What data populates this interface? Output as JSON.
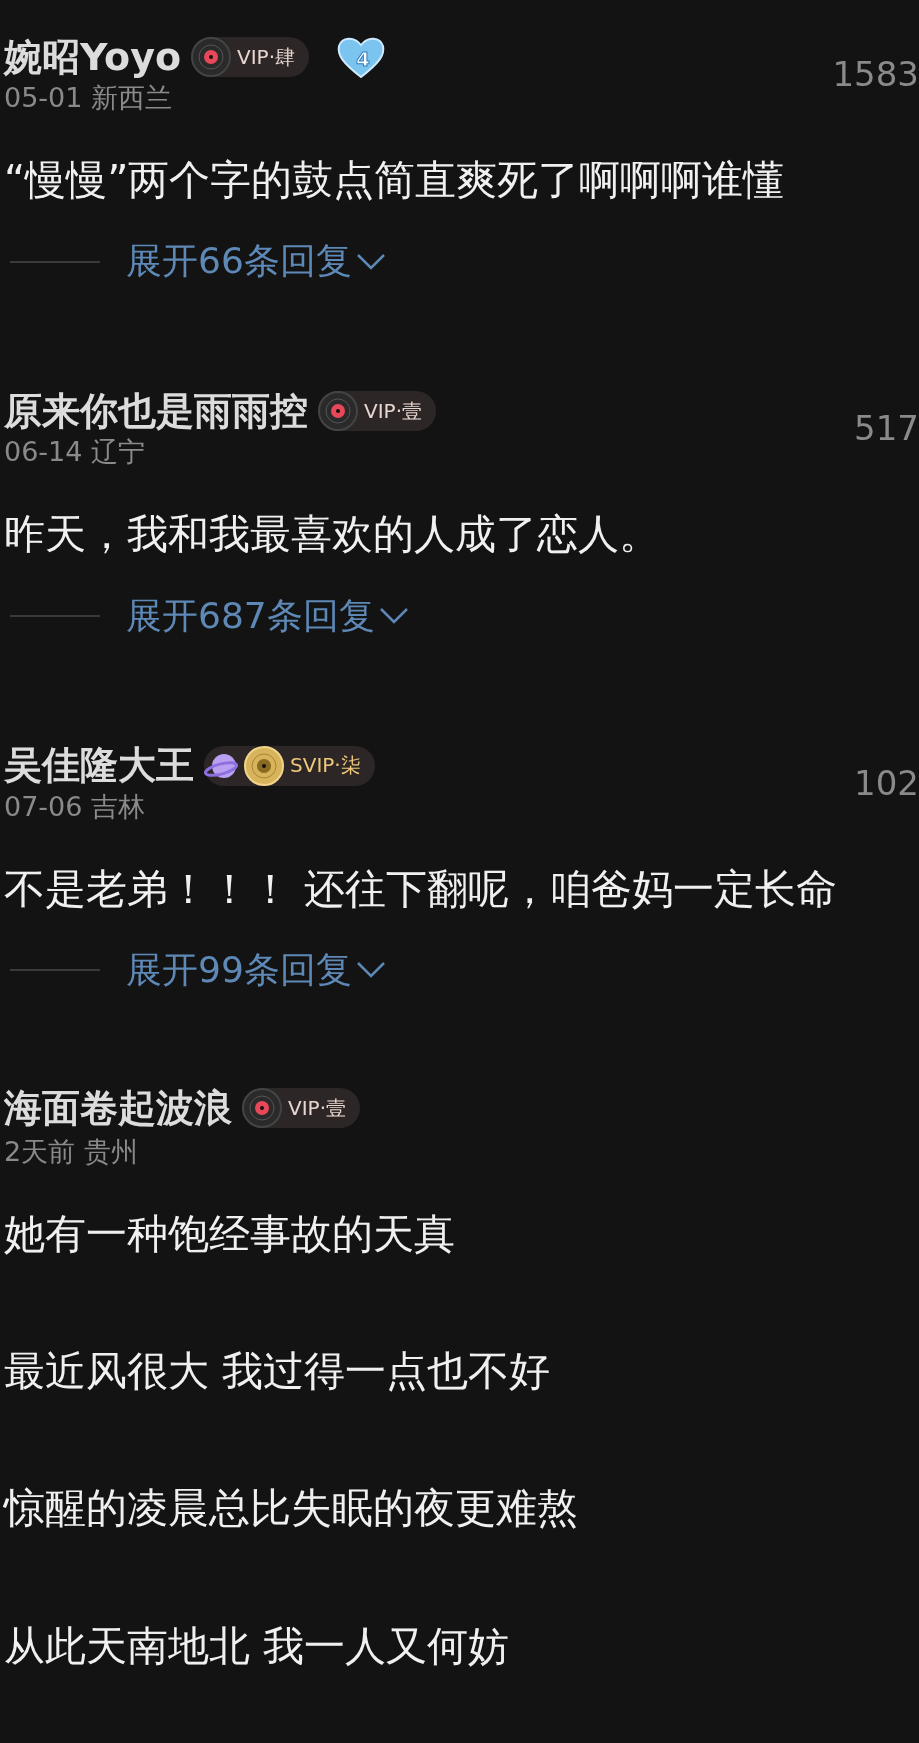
{
  "comments": [
    {
      "user": "婉昭Yoyo",
      "badge": {
        "kind": "vip",
        "label": "VIP·肆"
      },
      "fan_level": "4",
      "meta": "05-01 新西兰",
      "count": "1583",
      "lines": [
        "“慢慢”两个字的鼓点简直爽死了啊啊啊谁懂"
      ],
      "expand": "展开66条回复"
    },
    {
      "user": "原来你也是雨雨控",
      "badge": {
        "kind": "vip",
        "label": "VIP·壹"
      },
      "meta": "06-14 辽宁",
      "count": "517",
      "lines": [
        "昨天，我和我最喜欢的人成了恋人。"
      ],
      "expand": "展开687条回复"
    },
    {
      "user": "吴佳隆大王",
      "badge": {
        "kind": "svip",
        "label": "SVIP·柒"
      },
      "meta": "07-06 吉林",
      "count": "102",
      "lines": [
        "不是老弟！！！ 还往下翻呢，咱爸妈一定长命"
      ],
      "expand": "展开99条回复"
    },
    {
      "user": "海面卷起波浪",
      "badge": {
        "kind": "vip",
        "label": "VIP·壹"
      },
      "meta": "2天前 贵州",
      "lines": [
        "她有一种饱经事故的天真",
        "最近风很大 我过得一点也不好",
        "惊醒的凌晨总比失眠的夜更难熬",
        "从此天南地北 我一人又何妨"
      ]
    }
  ]
}
